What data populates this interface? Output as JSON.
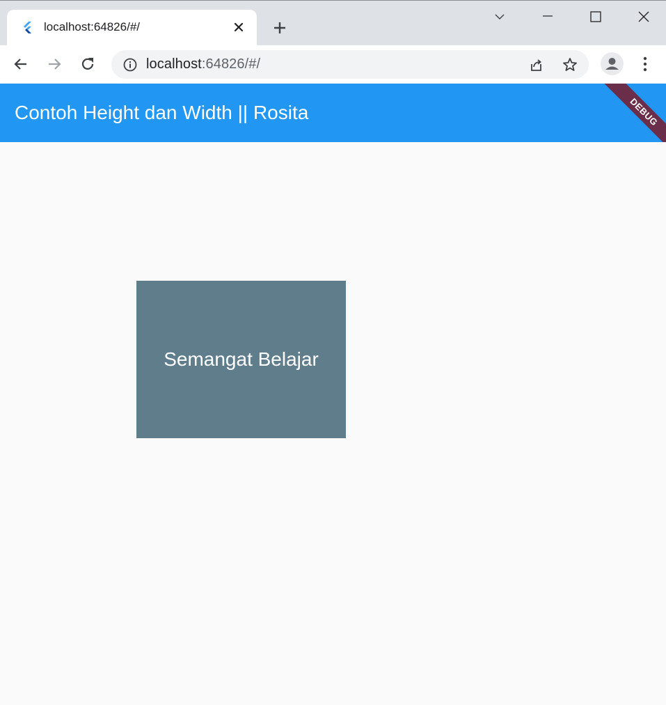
{
  "browser": {
    "tab": {
      "title": "localhost:64826/#/"
    },
    "address_bar": {
      "host": "localhost",
      "rest": ":64826/#/"
    }
  },
  "app": {
    "appbar_title": "Contoh Height dan Width || Rosita",
    "debug_banner": "DEBUG",
    "box_text": "Semangat Belajar"
  },
  "icons": [
    "flutter-favicon-icon",
    "close-icon",
    "plus-icon",
    "chevron-down-icon",
    "minimize-icon",
    "maximize-icon",
    "window-close-icon",
    "back-arrow-icon",
    "forward-arrow-icon",
    "reload-icon",
    "info-icon",
    "share-icon",
    "star-icon",
    "profile-icon",
    "more-vert-icon"
  ],
  "colors": {
    "appbar": "#2196f3",
    "box": "#607d8b",
    "debug_banner": "#6b2e4a",
    "background": "#fafafa"
  }
}
